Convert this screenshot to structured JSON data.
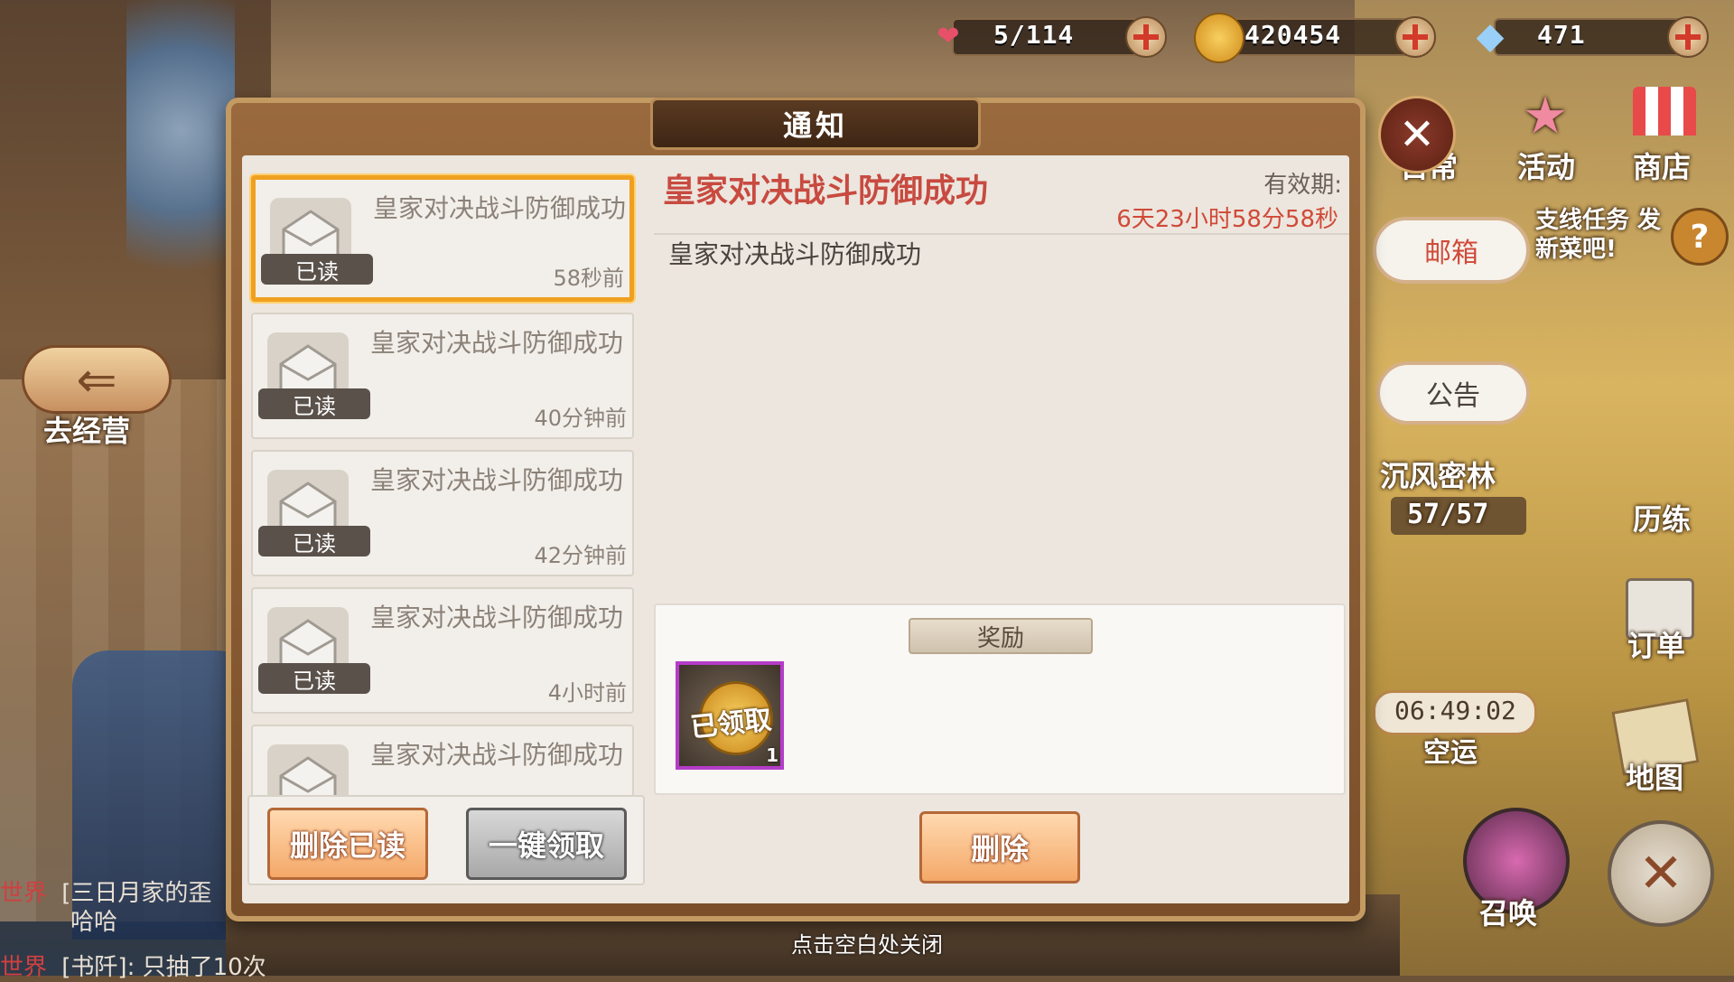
{
  "resources": {
    "stamina": {
      "value": "5/114",
      "icon": "heart-icon",
      "color": "#e8506a"
    },
    "gold": {
      "value": "420454",
      "icon": "gold-coin-icon",
      "color": "#f2b830"
    },
    "gems": {
      "value": "471",
      "icon": "crystal-icon",
      "color": "#7ab8f0"
    }
  },
  "dialog": {
    "title": "通知",
    "mails": [
      {
        "title": "皇家对决战斗防御成功",
        "status": "已读",
        "time": "58秒前",
        "selected": true
      },
      {
        "title": "皇家对决战斗防御成功",
        "status": "已读",
        "time": "40分钟前",
        "selected": false
      },
      {
        "title": "皇家对决战斗防御成功",
        "status": "已读",
        "time": "42分钟前",
        "selected": false
      },
      {
        "title": "皇家对决战斗防御成功",
        "status": "已读",
        "time": "4小时前",
        "selected": false
      },
      {
        "title": "皇家对决战斗防御成功",
        "status": "",
        "time": "",
        "selected": false
      }
    ],
    "delete_read_label": "删除已读",
    "claim_all_label": "一键领取",
    "detail": {
      "title": "皇家对决战斗防御成功",
      "valid_label": "有效期:",
      "valid_time": "6天23小时58分58秒",
      "body": "皇家对决战斗防御成功",
      "reward_label": "奖励",
      "reward_item": {
        "status": "已领取",
        "quantity": "1",
        "icon": "gold-medal-icon"
      },
      "delete_label": "删除"
    }
  },
  "side_menu": {
    "daily": "日常",
    "event": "活动",
    "shop": "商店",
    "mailbox": "邮箱",
    "notice": "公告",
    "quest_hint": "支线任务 发新菜吧!",
    "help": "?",
    "forest_name": "沉风密林",
    "forest_progress": "57/57",
    "trial": "历练",
    "orders": "订单",
    "airship_timer": "06:49:02",
    "airship": "空运",
    "map": "地图",
    "summon": "召唤"
  },
  "left_nav": {
    "manage": "去经营"
  },
  "chat": [
    {
      "channel": "世界",
      "text": "[三日月家的歪",
      "text2": "哈哈"
    },
    {
      "channel": "世界",
      "text": "[书阡]: 只抽了10次"
    }
  ],
  "close_hint": "点击空白处关闭"
}
